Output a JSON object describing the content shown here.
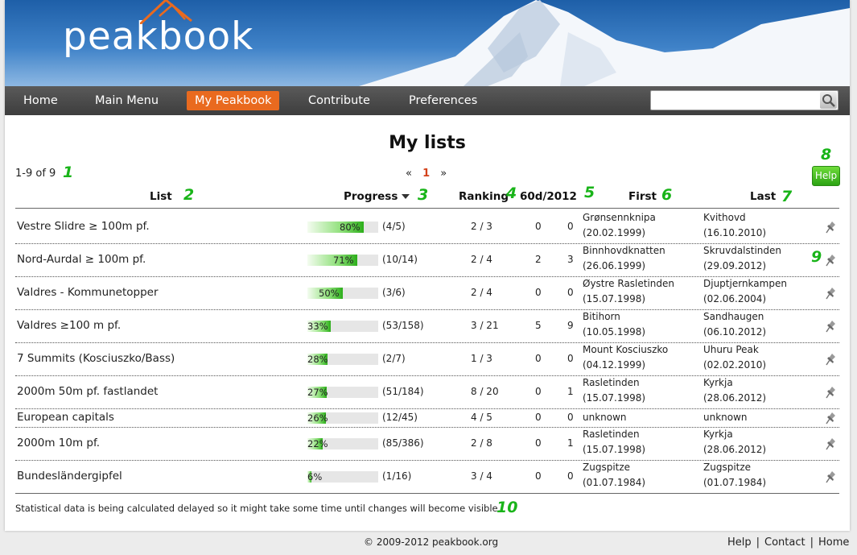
{
  "brand": {
    "logo_text": "peakbook"
  },
  "nav": {
    "items": [
      {
        "label": "Home",
        "active": false
      },
      {
        "label": "Main Menu",
        "active": false
      },
      {
        "label": "My Peakbook",
        "active": true
      },
      {
        "label": "Contribute",
        "active": false
      },
      {
        "label": "Preferences",
        "active": false
      }
    ],
    "search": {
      "value": "",
      "placeholder": ""
    },
    "accent": "#e96a1f"
  },
  "main": {
    "title": "My lists",
    "count": "1-9 of 9",
    "pager": {
      "prev": "«",
      "current": "1",
      "next": "»"
    },
    "help_label": "Help",
    "columns": {
      "list": "List",
      "progress": "Progress",
      "ranking": "Ranking",
      "days": "60d/2012",
      "first": "First",
      "last": "Last"
    },
    "annotations": [
      "1",
      "2",
      "3",
      "4",
      "5",
      "6",
      "7",
      "8",
      "9",
      "10"
    ],
    "rows": [
      {
        "name": "Vestre Slidre ≥ 100m pf.",
        "pct_label": "80%",
        "progress": 0.8,
        "fraction": "(4/5)",
        "ranking": "2 / 3",
        "d60": "0",
        "y2012": "0",
        "first_name": "Grønsennknipa",
        "first_date": "(20.02.1999)",
        "last_name": "Kvithovd",
        "last_date": "(16.10.2010)"
      },
      {
        "name": "Nord-Aurdal ≥ 100m pf.",
        "pct_label": "71%",
        "progress": 0.71,
        "fraction": "(10/14)",
        "ranking": "2 / 4",
        "d60": "2",
        "y2012": "3",
        "first_name": "Binnhovdknatten",
        "first_date": "(26.06.1999)",
        "last_name": "Skruvdalstinden",
        "last_date": "(29.09.2012)"
      },
      {
        "name": "Valdres - Kommunetopper",
        "pct_label": "50%",
        "progress": 0.5,
        "fraction": "(3/6)",
        "ranking": "2 / 4",
        "d60": "0",
        "y2012": "0",
        "first_name": "Øystre Rasletinden",
        "first_date": "(15.07.1998)",
        "last_name": "Djuptjernkampen",
        "last_date": "(02.06.2004)"
      },
      {
        "name": "Valdres ≥100 m pf.",
        "pct_label": "33%",
        "progress": 0.33,
        "fraction": "(53/158)",
        "ranking": "3 / 21",
        "d60": "5",
        "y2012": "9",
        "first_name": "Bitihorn",
        "first_date": "(10.05.1998)",
        "last_name": "Sandhaugen",
        "last_date": "(06.10.2012)"
      },
      {
        "name": "7 Summits (Kosciuszko/Bass)",
        "pct_label": "28%",
        "progress": 0.28,
        "fraction": "(2/7)",
        "ranking": "1 / 3",
        "d60": "0",
        "y2012": "0",
        "first_name": "Mount Kosciuszko",
        "first_date": "(04.12.1999)",
        "last_name": "Uhuru Peak",
        "last_date": "(02.02.2010)"
      },
      {
        "name": "2000m 50m pf. fastlandet",
        "pct_label": "27%",
        "progress": 0.27,
        "fraction": "(51/184)",
        "ranking": "8 / 20",
        "d60": "0",
        "y2012": "1",
        "first_name": "Rasletinden",
        "first_date": "(15.07.1998)",
        "last_name": "Kyrkja",
        "last_date": "(28.06.2012)"
      },
      {
        "name": "European capitals",
        "pct_label": "26%",
        "progress": 0.26,
        "fraction": "(12/45)",
        "ranking": "4 / 5",
        "d60": "0",
        "y2012": "0",
        "first_name": "unknown",
        "first_date": "",
        "last_name": "unknown",
        "last_date": ""
      },
      {
        "name": "2000m 10m pf.",
        "pct_label": "22%",
        "progress": 0.22,
        "fraction": "(85/386)",
        "ranking": "2 / 8",
        "d60": "0",
        "y2012": "1",
        "first_name": "Rasletinden",
        "first_date": "(15.07.1998)",
        "last_name": "Kyrkja",
        "last_date": "(28.06.2012)"
      },
      {
        "name": "Bundesländergipfel",
        "pct_label": "6%",
        "progress": 0.06,
        "fraction": "(1/16)",
        "ranking": "3 / 4",
        "d60": "0",
        "y2012": "0",
        "first_name": "Zugspitze",
        "first_date": "(01.07.1984)",
        "last_name": "Zugspitze",
        "last_date": "(01.07.1984)"
      }
    ],
    "note": "Statistical data is being calculated delayed so it might take some time until changes will become visible."
  },
  "footer": {
    "copyright": "© 2009-2012 peakbook.org",
    "links": [
      "Help",
      "Contact",
      "Home"
    ]
  }
}
